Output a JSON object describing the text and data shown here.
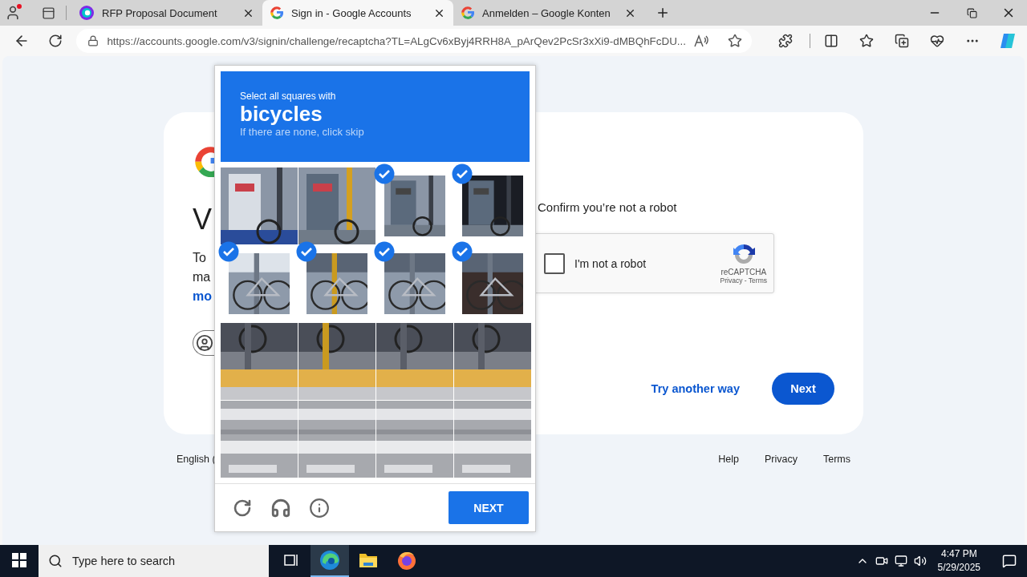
{
  "tabs": [
    {
      "title": "RFP Proposal Document",
      "kind": "circle",
      "selected": false
    },
    {
      "title": "Sign in - Google Accounts",
      "kind": "g",
      "selected": true
    },
    {
      "title": "Anmelden – Google Konten",
      "kind": "g",
      "selected": false
    }
  ],
  "address_bar": {
    "url": "https://accounts.google.com/v3/signin/challenge/recaptcha?TL=ALgCv6xByj4RRH8A_pArQev2PcSr3xXi9-dMBQhFcDU..."
  },
  "card": {
    "heading": "V",
    "lines": [
      "To",
      "ma"
    ],
    "link": "mo",
    "confirm": "Confirm you’re not a robot",
    "recaptcha": {
      "label": "I'm not a robot",
      "checked": false,
      "brand": "reCAPTCHA",
      "links": "Privacy - Terms"
    },
    "actions": [
      {
        "label": "Try another way",
        "kind": "link"
      },
      {
        "label": "Next",
        "kind": "primary"
      }
    ]
  },
  "footer": {
    "language": "English (",
    "links": [
      "Help",
      "Privacy",
      "Terms"
    ]
  },
  "challenge": {
    "instruction": "Select all squares with",
    "target": "bicycles",
    "hint": "If there are none, click skip",
    "tiles": [
      {
        "selected": false
      },
      {
        "selected": false
      },
      {
        "selected": true
      },
      {
        "selected": true
      },
      {
        "selected": true
      },
      {
        "selected": true
      },
      {
        "selected": true
      },
      {
        "selected": true
      },
      {
        "selected": false
      },
      {
        "selected": false
      },
      {
        "selected": false
      },
      {
        "selected": false
      },
      {
        "selected": false
      },
      {
        "selected": false
      },
      {
        "selected": false
      },
      {
        "selected": false
      }
    ],
    "button": "NEXT"
  },
  "taskbar": {
    "search_placeholder": "Type here to search",
    "apps": [
      {
        "kind": "taskview",
        "active": false
      },
      {
        "kind": "edge",
        "active": true
      },
      {
        "kind": "folder",
        "active": false
      },
      {
        "kind": "firefox",
        "active": false
      }
    ],
    "time": "4:47 PM",
    "date": "5/29/2025"
  }
}
